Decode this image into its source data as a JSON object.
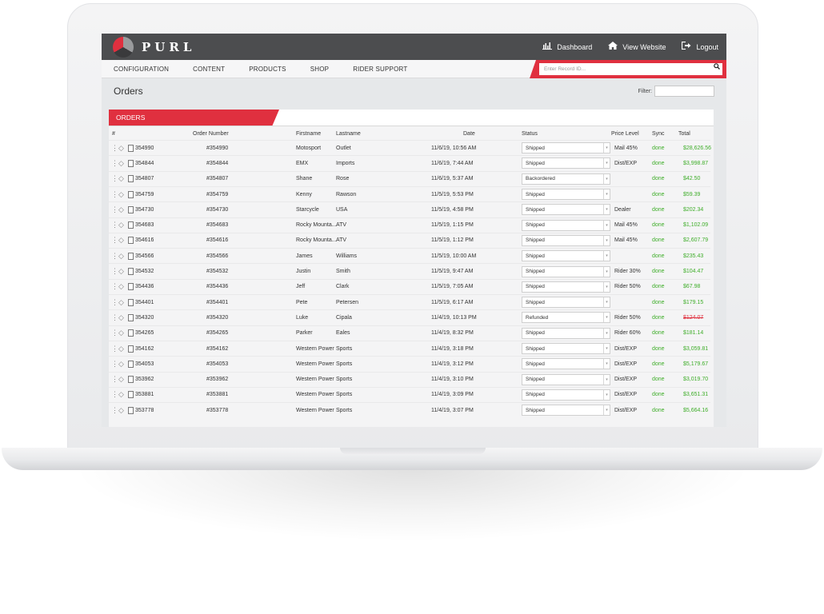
{
  "app": {
    "logo_text": "PURL",
    "colors": {
      "accent": "#e0303f",
      "topbar": "#4c4d4f",
      "success": "#3fae2a"
    }
  },
  "topbar": {
    "links": [
      {
        "label": "Dashboard",
        "icon": "chart-icon"
      },
      {
        "label": "View Website",
        "icon": "home-icon"
      },
      {
        "label": "Logout",
        "icon": "logout-icon"
      }
    ]
  },
  "nav": {
    "items": [
      "CONFIGURATION",
      "CONTENT",
      "PRODUCTS",
      "SHOP",
      "RIDER SUPPORT"
    ],
    "record_placeholder": "Enter Record ID..."
  },
  "page": {
    "title": "Orders",
    "filter_label": "Filter:"
  },
  "orders": {
    "tab_label": "ORDERS",
    "columns": {
      "num": "#",
      "order": "Order Number",
      "first": "Firstname",
      "last": "Lastname",
      "date": "Date",
      "status": "Status",
      "price": "Price Level",
      "sync": "Sync",
      "total": "Total"
    },
    "rows": [
      {
        "id": "354990",
        "order": "#354990",
        "first": "Motosport",
        "last": "Outlet",
        "date": "11/6/19, 10:56 AM",
        "status": "Shipped",
        "price": "Mail 45%",
        "sync": "done",
        "total": "$28,626.56",
        "refunded": false
      },
      {
        "id": "354844",
        "order": "#354844",
        "first": "EMX",
        "last": "Imports",
        "date": "11/6/19, 7:44 AM",
        "status": "Shipped",
        "price": "Dist/EXP",
        "sync": "done",
        "total": "$3,998.87",
        "refunded": false
      },
      {
        "id": "354807",
        "order": "#354807",
        "first": "Shane",
        "last": "Rose",
        "date": "11/6/19, 5:37 AM",
        "status": "Backordered",
        "price": "",
        "sync": "done",
        "total": "$42.50",
        "refunded": false
      },
      {
        "id": "354759",
        "order": "#354759",
        "first": "Kenny",
        "last": "Rawson",
        "date": "11/5/19, 5:53 PM",
        "status": "Shipped",
        "price": "",
        "sync": "done",
        "total": "$59.39",
        "refunded": false
      },
      {
        "id": "354730",
        "order": "#354730",
        "first": "Starcycle",
        "last": "USA",
        "date": "11/5/19, 4:58 PM",
        "status": "Shipped",
        "price": "Dealer",
        "sync": "done",
        "total": "$202.34",
        "refunded": false
      },
      {
        "id": "354683",
        "order": "#354683",
        "first": "Rocky Mounta...",
        "last": "ATV",
        "date": "11/5/19, 1:15 PM",
        "status": "Shipped",
        "price": "Mail 45%",
        "sync": "done",
        "total": "$1,102.09",
        "refunded": false
      },
      {
        "id": "354616",
        "order": "#354616",
        "first": "Rocky Mounta...",
        "last": "ATV",
        "date": "11/5/19, 1:12 PM",
        "status": "Shipped",
        "price": "Mail 45%",
        "sync": "done",
        "total": "$2,607.79",
        "refunded": false
      },
      {
        "id": "354566",
        "order": "#354566",
        "first": "James",
        "last": "Williams",
        "date": "11/5/19, 10:00 AM",
        "status": "Shipped",
        "price": "",
        "sync": "done",
        "total": "$235.43",
        "refunded": false
      },
      {
        "id": "354532",
        "order": "#354532",
        "first": "Justin",
        "last": "Smith",
        "date": "11/5/19, 9:47 AM",
        "status": "Shipped",
        "price": "Rider 30%",
        "sync": "done",
        "total": "$104.47",
        "refunded": false
      },
      {
        "id": "354436",
        "order": "#354436",
        "first": "Jeff",
        "last": "Clark",
        "date": "11/5/19, 7:05 AM",
        "status": "Shipped",
        "price": "Rider 50%",
        "sync": "done",
        "total": "$67.98",
        "refunded": false
      },
      {
        "id": "354401",
        "order": "#354401",
        "first": "Pete",
        "last": "Petersen",
        "date": "11/5/19, 6:17 AM",
        "status": "Shipped",
        "price": "",
        "sync": "done",
        "total": "$179.15",
        "refunded": false
      },
      {
        "id": "354320",
        "order": "#354320",
        "first": "Luke",
        "last": "Cipala",
        "date": "11/4/19, 10:13 PM",
        "status": "Refunded",
        "price": "Rider 50%",
        "sync": "done",
        "total": "$124.07",
        "refunded": true
      },
      {
        "id": "354265",
        "order": "#354265",
        "first": "Parker",
        "last": "Eales",
        "date": "11/4/19, 8:32 PM",
        "status": "Shipped",
        "price": "Rider 60%",
        "sync": "done",
        "total": "$181.14",
        "refunded": false
      },
      {
        "id": "354162",
        "order": "#354162",
        "first": "Western Power",
        "last": "Sports",
        "date": "11/4/19, 3:18 PM",
        "status": "Shipped",
        "price": "Dist/EXP",
        "sync": "done",
        "total": "$3,059.81",
        "refunded": false
      },
      {
        "id": "354053",
        "order": "#354053",
        "first": "Western Power",
        "last": "Sports",
        "date": "11/4/19, 3:12 PM",
        "status": "Shipped",
        "price": "Dist/EXP",
        "sync": "done",
        "total": "$5,179.67",
        "refunded": false
      },
      {
        "id": "353962",
        "order": "#353962",
        "first": "Western Power",
        "last": "Sports",
        "date": "11/4/19, 3:10 PM",
        "status": "Shipped",
        "price": "Dist/EXP",
        "sync": "done",
        "total": "$3,019.70",
        "refunded": false
      },
      {
        "id": "353881",
        "order": "#353881",
        "first": "Western Power",
        "last": "Sports",
        "date": "11/4/19, 3:09 PM",
        "status": "Shipped",
        "price": "Dist/EXP",
        "sync": "done",
        "total": "$3,651.31",
        "refunded": false
      },
      {
        "id": "353778",
        "order": "#353778",
        "first": "Western Power",
        "last": "Sports",
        "date": "11/4/19, 3:07 PM",
        "status": "Shipped",
        "price": "Dist/EXP",
        "sync": "done",
        "total": "$5,664.16",
        "refunded": false
      }
    ]
  }
}
